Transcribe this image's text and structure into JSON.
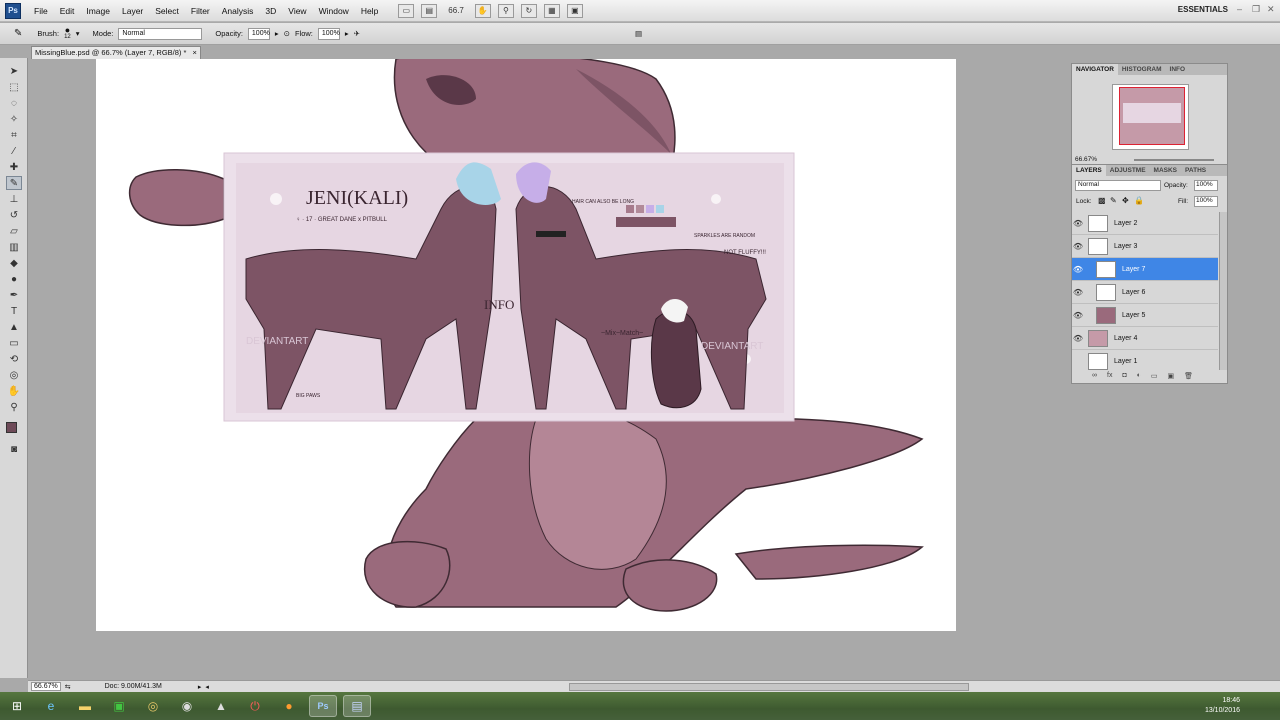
{
  "app": {
    "logo": "Ps"
  },
  "menu": [
    "File",
    "Edit",
    "Image",
    "Layer",
    "Select",
    "Filter",
    "Analysis",
    "3D",
    "View",
    "Window",
    "Help"
  ],
  "menubar": {
    "zoom": "66.7",
    "workspace": "ESSENTIALS"
  },
  "options": {
    "brush_label": "Brush:",
    "brush_size": "12",
    "mode_label": "Mode:",
    "mode_value": "Normal",
    "opacity_label": "Opacity:",
    "opacity_value": "100%",
    "flow_label": "Flow:",
    "flow_value": "100%"
  },
  "document": {
    "tab_title": "MissingBlue.psd @ 66.7% (Layer 7, RGB/8) *"
  },
  "status": {
    "zoom": "66.67%",
    "doc": "Doc: 9.00M/41.3M"
  },
  "navigator": {
    "tabs": [
      "NAVIGATOR",
      "HISTOGRAM",
      "INFO"
    ],
    "zoom": "66.67%"
  },
  "layers": {
    "tabs": [
      "LAYERS",
      "ADJUSTME",
      "MASKS",
      "PATHS"
    ],
    "blend": "Normal",
    "opacity_label": "Opacity:",
    "opacity": "100%",
    "lock_label": "Lock:",
    "fill_label": "Fill:",
    "fill": "100%",
    "items": [
      {
        "name": "Layer 2",
        "selected": false
      },
      {
        "name": "Layer 3",
        "selected": false
      },
      {
        "name": "Layer 7",
        "selected": true
      },
      {
        "name": "Layer 6",
        "selected": false
      },
      {
        "name": "Layer 5",
        "selected": false
      },
      {
        "name": "Layer 4",
        "selected": false
      },
      {
        "name": "Layer 1",
        "selected": false
      }
    ]
  },
  "artwork": {
    "title": "JENI(KALI)",
    "subtitle": "♀ · 17 · GREAT DANE x PITBULL",
    "info_heading": "INFO",
    "mix_heading": "~Mix~Match~",
    "watermark": "DEVIANTART",
    "note_not_fluffy": "NOT FLUFFY!!!",
    "note_long": "HAIR CAN ALSO BE LONG",
    "note_random": "SPARKLES ARE RANDOM",
    "note_big_paws": "BIG PAWS"
  },
  "clock": {
    "time": "18:46",
    "date": "13/10/2016"
  },
  "colors": {
    "fur": "#9a6a7c",
    "fur_dark": "#5a3848",
    "panel_highlight": "#3f86e6"
  }
}
